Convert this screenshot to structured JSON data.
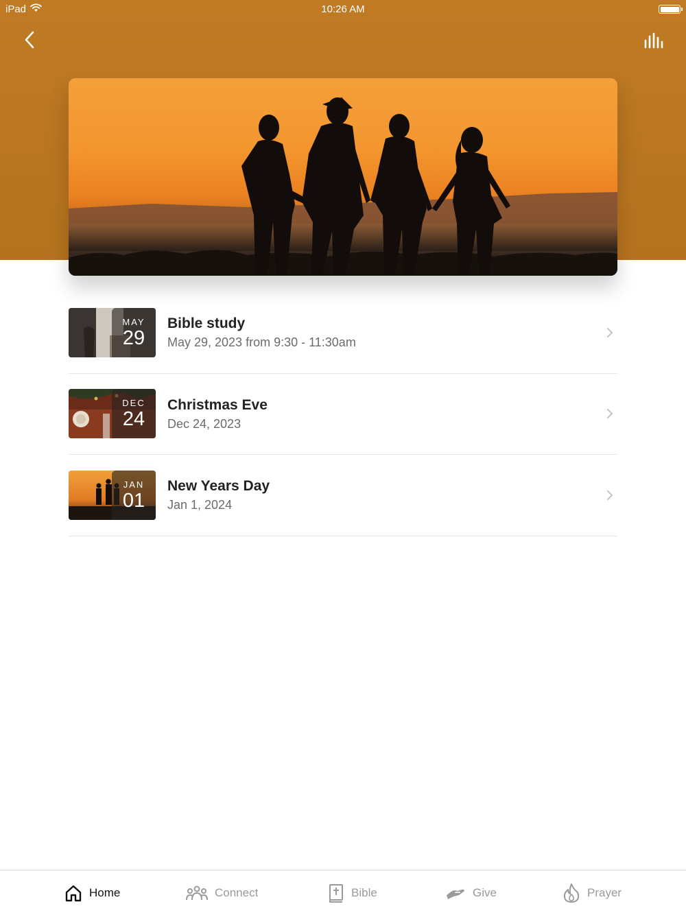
{
  "status_bar": {
    "device": "iPad",
    "time": "10:26 AM"
  },
  "header": {
    "back_icon": "chevron-left-icon",
    "stats_icon": "audio-bars-icon",
    "background_color": "#c07a24"
  },
  "hero": {
    "image": "family-silhouette-sunset"
  },
  "events": [
    {
      "title": "Bible study",
      "subtitle": "May 29, 2023 from 9:30 - 11:30am",
      "month": "MAY",
      "day": "29",
      "thumbnail": "bible-study-photo"
    },
    {
      "title": "Christmas Eve",
      "subtitle": "Dec 24, 2023",
      "month": "DEC",
      "day": "24",
      "thumbnail": "christmas-table-photo"
    },
    {
      "title": "New Years Day",
      "subtitle": "Jan 1, 2024",
      "month": "JAN",
      "day": "01",
      "thumbnail": "family-sunset-photo"
    }
  ],
  "tab_bar": {
    "items": [
      {
        "label": "Home",
        "icon": "home-icon",
        "active": true
      },
      {
        "label": "Connect",
        "icon": "people-icon",
        "active": false
      },
      {
        "label": "Bible",
        "icon": "bible-icon",
        "active": false
      },
      {
        "label": "Give",
        "icon": "giving-hand-icon",
        "active": false
      },
      {
        "label": "Prayer",
        "icon": "flame-icon",
        "active": false
      }
    ]
  }
}
